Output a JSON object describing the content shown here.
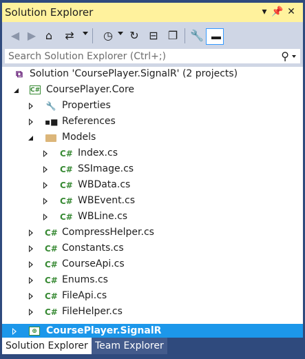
{
  "panel": {
    "title": "Solution Explorer",
    "title_buttons": [
      "▾",
      "📌",
      "✕"
    ]
  },
  "toolbar": {
    "items": [
      {
        "name": "back-icon",
        "glyph": "◀"
      },
      {
        "name": "forward-icon",
        "glyph": "▶"
      },
      {
        "name": "home-icon",
        "glyph": "⌂"
      },
      {
        "name": "switch-views-icon",
        "glyph": "⇄"
      },
      {
        "name": "pending-changes-filter-icon",
        "glyph": "◷"
      },
      {
        "name": "refresh-icon",
        "glyph": "↻"
      },
      {
        "name": "collapse-all-icon",
        "glyph": "⊟"
      },
      {
        "name": "show-all-files-icon",
        "glyph": "❐"
      },
      {
        "name": "properties-icon",
        "glyph": "🔧"
      }
    ]
  },
  "search": {
    "placeholder": "Search Solution Explorer (Ctrl+;)"
  },
  "tree": {
    "rows": [
      {
        "label": "Solution 'CoursePlayer.SignalR' (2 projects)",
        "type": "solution"
      },
      {
        "label": "CoursePlayer.Core",
        "type": "project"
      },
      {
        "label": "Properties",
        "type": "properties"
      },
      {
        "label": "References",
        "type": "references"
      },
      {
        "label": "Models",
        "type": "folder"
      },
      {
        "label": "Index.cs",
        "type": "cs"
      },
      {
        "label": "SSImage.cs",
        "type": "cs"
      },
      {
        "label": "WBData.cs",
        "type": "cs"
      },
      {
        "label": "WBEvent.cs",
        "type": "cs"
      },
      {
        "label": "WBLine.cs",
        "type": "cs"
      },
      {
        "label": "CompressHelper.cs",
        "type": "cs"
      },
      {
        "label": "Constants.cs",
        "type": "cs"
      },
      {
        "label": "CourseApi.cs",
        "type": "cs"
      },
      {
        "label": "Enums.cs",
        "type": "cs"
      },
      {
        "label": "FileApi.cs",
        "type": "cs"
      },
      {
        "label": "FileHelper.cs",
        "type": "cs"
      },
      {
        "label": "CoursePlayer.SignalR",
        "type": "project-selected"
      }
    ]
  },
  "tabs": {
    "active": "Solution Explorer",
    "inactive": "Team Explorer"
  },
  "colors": {
    "title_bar": "#fff29d",
    "selection": "#1c97ea",
    "cs_icon": "#388a34",
    "frame": "#2f4a7d"
  }
}
